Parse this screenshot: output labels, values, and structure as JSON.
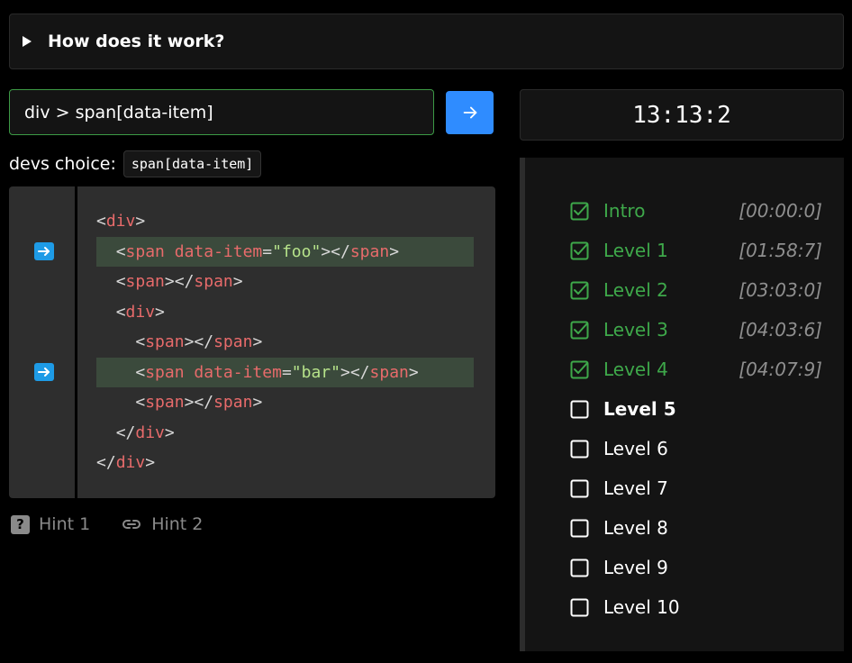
{
  "accordion": {
    "title": "How does it work?"
  },
  "selector": {
    "value": "div > span[data-item]"
  },
  "devs": {
    "label": "devs choice:",
    "code": "span[data-item]"
  },
  "code_lines": [
    {
      "indent": 0,
      "tag": "div",
      "closing": false
    },
    {
      "indent": 1,
      "tag": "span",
      "attr": "data-item",
      "value": "foo",
      "inline_close": true,
      "highlighted": true
    },
    {
      "indent": 1,
      "tag": "span",
      "inline_close": true
    },
    {
      "indent": 1,
      "tag": "div",
      "closing": false
    },
    {
      "indent": 2,
      "tag": "span",
      "inline_close": true
    },
    {
      "indent": 2,
      "tag": "span",
      "attr": "data-item",
      "value": "bar",
      "inline_close": true,
      "highlighted": true
    },
    {
      "indent": 2,
      "tag": "span",
      "inline_close": true
    },
    {
      "indent": 1,
      "tag": "div",
      "closing": true
    },
    {
      "indent": 0,
      "tag": "div",
      "closing": true
    }
  ],
  "hints": {
    "hint1": "Hint 1",
    "hint2": "Hint 2"
  },
  "timer": {
    "value": "13:13:2"
  },
  "levels": [
    {
      "name": "Intro",
      "time": "[00:00:0]",
      "status": "done"
    },
    {
      "name": "Level 1",
      "time": "[01:58:7]",
      "status": "done"
    },
    {
      "name": "Level 2",
      "time": "[03:03:0]",
      "status": "done"
    },
    {
      "name": "Level 3",
      "time": "[04:03:6]",
      "status": "done"
    },
    {
      "name": "Level 4",
      "time": "[04:07:9]",
      "status": "done"
    },
    {
      "name": "Level 5",
      "time": "",
      "status": "current"
    },
    {
      "name": "Level 6",
      "time": "",
      "status": "todo"
    },
    {
      "name": "Level 7",
      "time": "",
      "status": "todo"
    },
    {
      "name": "Level 8",
      "time": "",
      "status": "todo"
    },
    {
      "name": "Level 9",
      "time": "",
      "status": "todo"
    },
    {
      "name": "Level 10",
      "time": "",
      "status": "todo"
    }
  ],
  "colors": {
    "accent_blue": "#2f8cff",
    "success_green": "#3ea84a",
    "highlight_row": "#3b4a3c",
    "tag_red": "#e86b6b",
    "string_green": "#b6e38a"
  },
  "icons": {
    "accordion": "triangle-right-icon",
    "submit": "arrow-right-icon",
    "marker": "arrow-right-box-icon",
    "hint1": "question-box-icon",
    "hint2": "link-icon",
    "level_done": "checkbox-checked-icon",
    "level_todo": "checkbox-empty-icon"
  }
}
